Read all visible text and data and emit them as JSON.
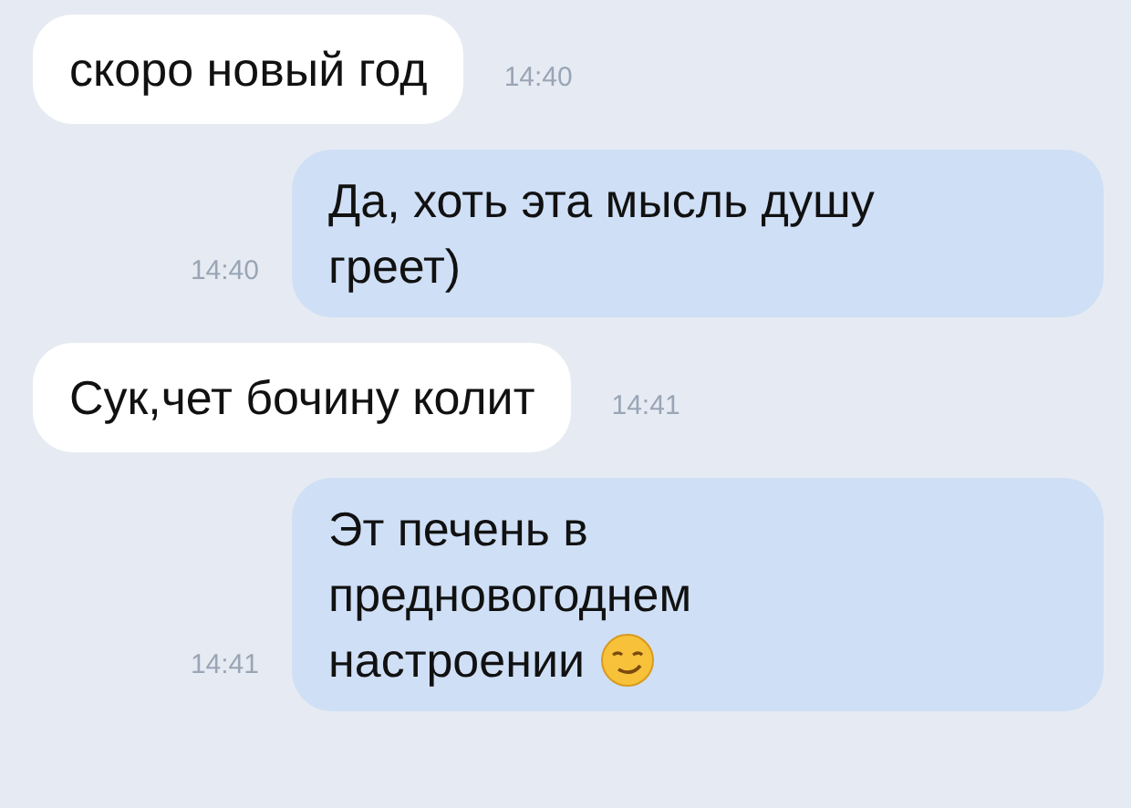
{
  "messages": [
    {
      "kind": "incoming",
      "lines": [
        "скоро новый год"
      ],
      "time": "14:40"
    },
    {
      "kind": "outgoing",
      "lines": [
        "Да, хоть эта мысль душу",
        "греет)"
      ],
      "time": "14:40"
    },
    {
      "kind": "incoming",
      "lines": [
        "Сук,чет бочину колит"
      ],
      "time": "14:41"
    },
    {
      "kind": "outgoing",
      "lines": [
        "Эт печень в",
        "предновогоднем",
        "настроении"
      ],
      "time": "14:41",
      "smiley": true
    }
  ]
}
